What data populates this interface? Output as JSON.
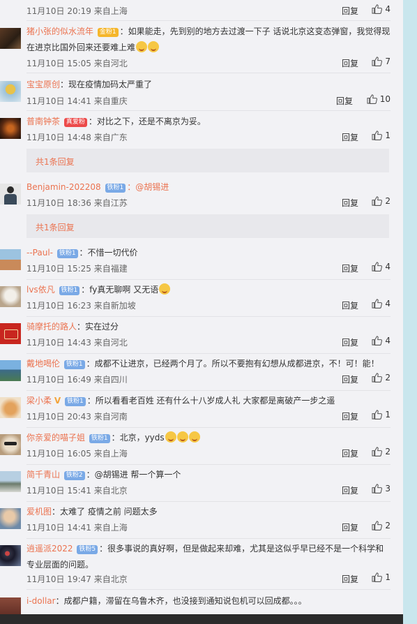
{
  "colors": {
    "accent": "#eb7350",
    "badge_blue": "#7aa9e6",
    "badge_gold": "#f5b62b",
    "panel_bg": "#f2f2f5"
  },
  "labels": {
    "reply": "回复",
    "more_replies": "共1条回复"
  },
  "comments": [
    {
      "user": "",
      "badge": "",
      "text": "",
      "meta": "11月10日 20:19 来自上海",
      "likes": "4"
    },
    {
      "user": "猪小张的似水流年",
      "badge": "金粉1",
      "text": "：如果能走，先到别的地方去过渡一下子 话说北京这变态弹窗，我觉得现在进京比国外回来还要难上难",
      "meta": "11月10日 15:05 来自河北",
      "likes": "7"
    },
    {
      "user": "宝宝原创",
      "badge": "",
      "text": "：现在疫情加码太严重了",
      "meta": "11月10日 14:41 来自重庆",
      "likes": "10"
    },
    {
      "user": "普南钟茶",
      "badge": "真爱粉",
      "text": "：对比之下，还是不离京为妥。",
      "meta": "11月10日 14:48 来自广东",
      "likes": "1"
    },
    {
      "user": "Benjamin-202208",
      "badge": "铁粉1",
      "text": "：@胡锡进",
      "meta": "11月10日 18:36 来自江苏",
      "likes": "2"
    },
    {
      "user": "--Paul-",
      "badge": "铁粉1",
      "text": "：不惜一切代价",
      "meta": "11月10日 15:25 来自福建",
      "likes": "4"
    },
    {
      "user": "lvs依凡",
      "badge": "铁粉1",
      "text": "：fy真无聊啊 又无语",
      "meta": "11月10日 16:23 来自新加坡",
      "likes": "4"
    },
    {
      "user": "骑摩托的路人",
      "badge": "",
      "text": "：实在过分",
      "meta": "11月10日 14:43 来自河北",
      "likes": "4"
    },
    {
      "user": "戴地喝伦",
      "badge": "铁粉1",
      "text": "：成都不让进京，已经两个月了。所以不要抱有幻想从成都进京，不！可！能！",
      "meta": "11月10日 16:49 来自四川",
      "likes": "2"
    },
    {
      "user": "梁小柔",
      "badge": "铁粉1",
      "text": "：所以看看老百姓 还有什么十八岁成人礼 大家都是离破产一步之遥",
      "meta": "11月10日 20:43 来自河南",
      "likes": "1"
    },
    {
      "user": "你亲爱的喵子姐",
      "badge": "铁粉1",
      "text": "：北京，yyds",
      "meta": "11月10日 16:05 来自上海",
      "likes": "2"
    },
    {
      "user": "简千青山",
      "badge": "铁粉2",
      "text": "：@胡锡进 帮一个算一个",
      "meta": "11月10日 15:41 来自北京",
      "likes": "3"
    },
    {
      "user": "爱机图",
      "badge": "",
      "text": "：太难了 疫情之前 问题太多",
      "meta": "11月10日 14:41 来自上海",
      "likes": "2"
    },
    {
      "user": "逍遥派2022",
      "badge": "铁粉5",
      "text": "：很多事说的真好啊，但是做起来却难，尤其是这似乎早已经不是一个科学和专业层面的问题。",
      "meta": "11月10日 19:47 来自北京",
      "likes": "1"
    },
    {
      "user": "i-dollar",
      "badge": "",
      "text": "：成都户籍，滞留在乌鲁木齐，也没接到通知说包机可以回成都。。。",
      "meta": "",
      "likes": ""
    }
  ]
}
